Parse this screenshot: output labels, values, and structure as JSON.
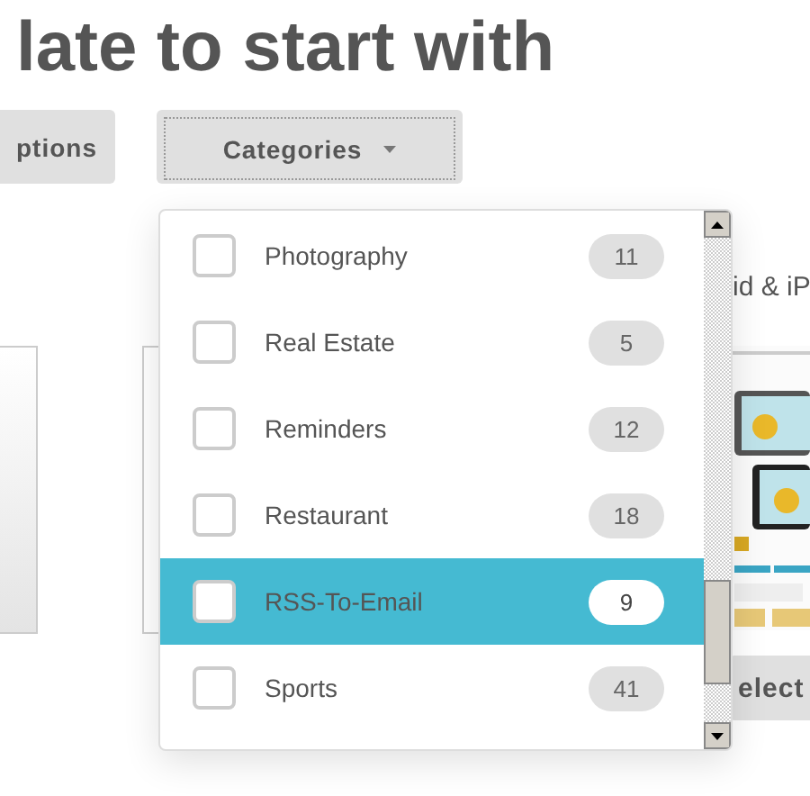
{
  "heading": "late to start with",
  "toolbar": {
    "options_button": "ptions",
    "categories_button": "Categories"
  },
  "side_text": "id & iP",
  "select_button": "elect",
  "dropdown": {
    "items": [
      {
        "label": "Photography",
        "count": "11",
        "checked": false,
        "selected": false
      },
      {
        "label": "Real Estate",
        "count": "5",
        "checked": false,
        "selected": false
      },
      {
        "label": "Reminders",
        "count": "12",
        "checked": false,
        "selected": false
      },
      {
        "label": "Restaurant",
        "count": "18",
        "checked": false,
        "selected": false
      },
      {
        "label": "RSS-To-Email",
        "count": "9",
        "checked": false,
        "selected": true
      },
      {
        "label": "Sports",
        "count": "41",
        "checked": false,
        "selected": false
      }
    ]
  }
}
